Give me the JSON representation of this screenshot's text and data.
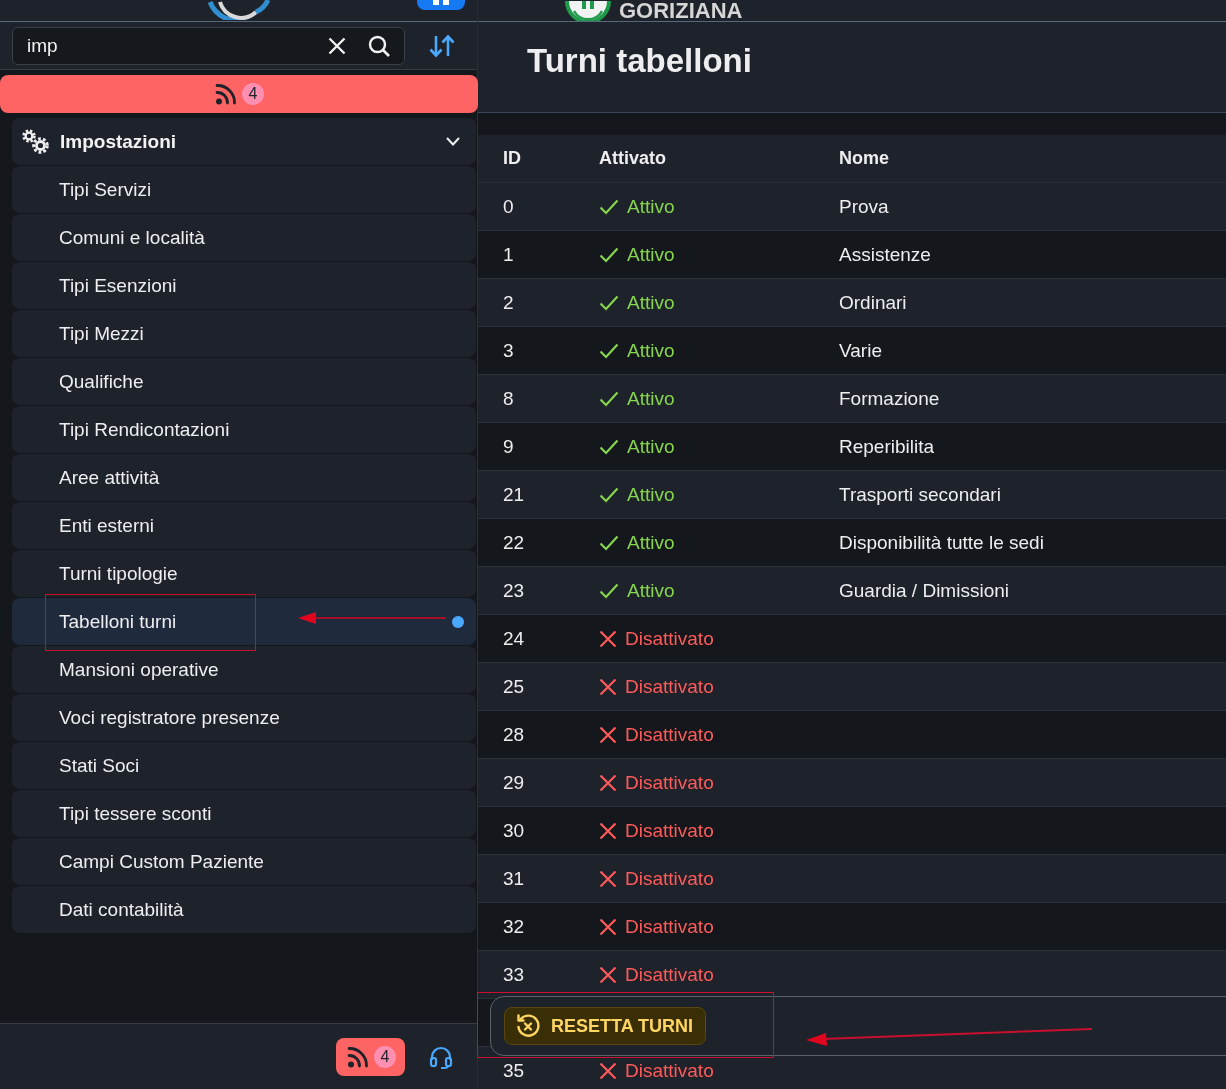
{
  "header": {
    "brand": "GORIZIANA"
  },
  "sidebar": {
    "search": {
      "value": "imp"
    },
    "feed_banner": {
      "count": "4"
    },
    "menu": {
      "label": "Impostazioni",
      "expanded": true,
      "children": [
        {
          "label": "Tipi Servizi",
          "selected": false
        },
        {
          "label": "Comuni e località",
          "selected": false
        },
        {
          "label": "Tipi Esenzioni",
          "selected": false
        },
        {
          "label": "Tipi Mezzi",
          "selected": false
        },
        {
          "label": "Qualifiche",
          "selected": false
        },
        {
          "label": "Tipi Rendicontazioni",
          "selected": false
        },
        {
          "label": "Aree attività",
          "selected": false
        },
        {
          "label": "Enti esterni",
          "selected": false
        },
        {
          "label": "Turni tipologie",
          "selected": false
        },
        {
          "label": "Tabelloni turni",
          "selected": true
        },
        {
          "label": "Mansioni operative",
          "selected": false
        },
        {
          "label": "Voci registratore presenze",
          "selected": false
        },
        {
          "label": "Stati Soci",
          "selected": false
        },
        {
          "label": "Tipi tessere sconti",
          "selected": false
        },
        {
          "label": "Campi Custom Paziente",
          "selected": false
        },
        {
          "label": "Dati contabilità",
          "selected": false
        }
      ]
    },
    "footer": {
      "feed_count": "4"
    }
  },
  "page": {
    "title": "Turni tabelloni"
  },
  "table": {
    "columns": [
      "ID",
      "Attivato",
      "Nome"
    ],
    "rows": [
      {
        "id": "0",
        "status": "Attivo",
        "active": true,
        "name": "Prova"
      },
      {
        "id": "1",
        "status": "Attivo",
        "active": true,
        "name": "Assistenze"
      },
      {
        "id": "2",
        "status": "Attivo",
        "active": true,
        "name": "Ordinari"
      },
      {
        "id": "3",
        "status": "Attivo",
        "active": true,
        "name": "Varie"
      },
      {
        "id": "8",
        "status": "Attivo",
        "active": true,
        "name": "Formazione"
      },
      {
        "id": "9",
        "status": "Attivo",
        "active": true,
        "name": "Reperibilita"
      },
      {
        "id": "21",
        "status": "Attivo",
        "active": true,
        "name": "Trasporti secondari"
      },
      {
        "id": "22",
        "status": "Attivo",
        "active": true,
        "name": "Disponibilità tutte le sedi"
      },
      {
        "id": "23",
        "status": "Attivo",
        "active": true,
        "name": "Guardia / Dimissioni"
      },
      {
        "id": "24",
        "status": "Disattivato",
        "active": false
      },
      {
        "id": "25",
        "status": "Disattivato",
        "active": false
      },
      {
        "id": "28",
        "status": "Disattivato",
        "active": false
      },
      {
        "id": "29",
        "status": "Disattivato",
        "active": false
      },
      {
        "id": "30",
        "status": "Disattivato",
        "active": false
      },
      {
        "id": "31",
        "status": "Disattivato",
        "active": false
      },
      {
        "id": "32",
        "status": "Disattivato",
        "active": false
      },
      {
        "id": "33",
        "status": "Disattivato",
        "active": false
      }
    ],
    "rows_below_bar": [
      {
        "id": "35",
        "status": "Disattivato",
        "active": false
      }
    ]
  },
  "action_bar": {
    "button": "RESETTA TURNI"
  }
}
